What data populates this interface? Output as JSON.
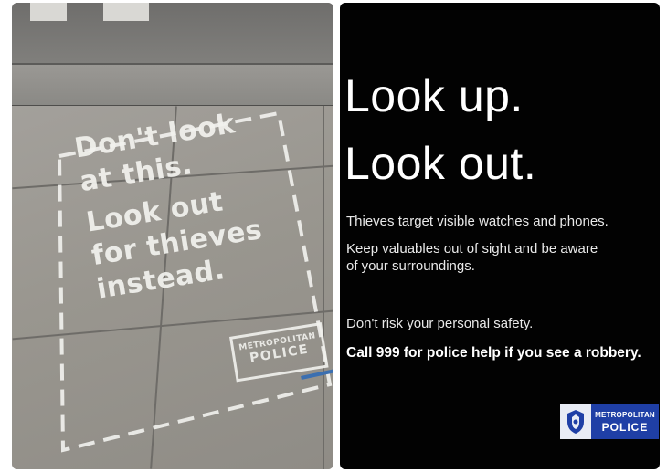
{
  "left_photo": {
    "stencil_lines": [
      "Don't look",
      "at this.",
      "Look out",
      "for thieves",
      "instead."
    ],
    "logo": {
      "line1": "METROPOLITAN",
      "line2": "POLICE"
    },
    "colors": {
      "stencil": "#f2f2ee",
      "pavement": "#9b9893",
      "marker": "#3b6fb0"
    }
  },
  "right_poster": {
    "headline": [
      "Look up.",
      "Look out."
    ],
    "body": [
      "Thieves target visible watches and phones.",
      "Keep valuables out of sight and be aware",
      "of your surroundings.",
      "Don't risk your personal safety."
    ],
    "call_to_action": "Call 999 for police help if you see a robbery.",
    "logo": {
      "line1": "METROPOLITAN",
      "line2": "POLICE"
    },
    "colors": {
      "background": "#020202",
      "text": "#ffffff",
      "logo_blue": "#1f3fa6"
    }
  }
}
